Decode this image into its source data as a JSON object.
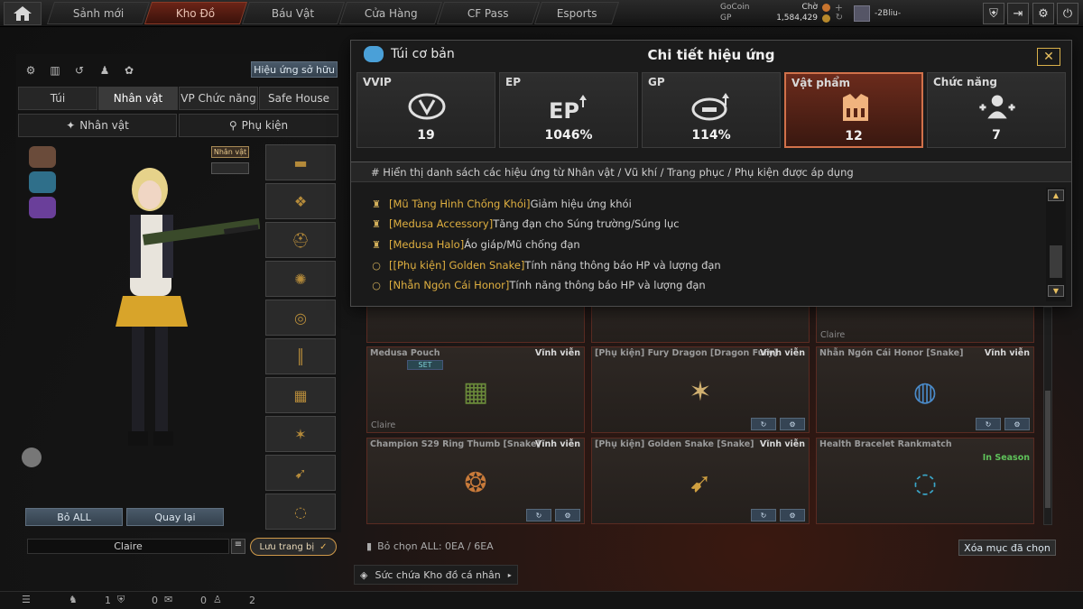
{
  "nav": {
    "tabs": [
      "Sảnh mới",
      "Kho Đồ",
      "Báu Vật",
      "Cửa Hàng",
      "CF Pass",
      "Esports"
    ],
    "active_tab": "Kho Đồ"
  },
  "currency": {
    "gocoin_label": "GoCoin",
    "gp_label": "GP",
    "gocoin_value": "Chờ",
    "gp_value": "1,584,429"
  },
  "user": {
    "name": "-2Bliu-"
  },
  "left": {
    "owned_effects_button": "Hiệu ứng sở hữu",
    "tabs": [
      "Túi",
      "Nhân vật",
      "VP Chức năng",
      "Safe House"
    ],
    "subtabs": [
      "Nhân vật",
      "Phụ kiện"
    ],
    "character_badge": "Nhân vật",
    "clear_all_button": "Bỏ ALL",
    "back_button": "Quay lại",
    "character_name": "Claire",
    "save_button": "Lưu trang bị"
  },
  "dialog": {
    "bag_title": "Túi cơ bản",
    "title": "Chi tiết hiệu ứng",
    "stats": [
      {
        "label": "VVIP",
        "value": "19",
        "icon": "vvip-icon"
      },
      {
        "label": "EP",
        "value": "1046%",
        "icon": "ep-up-icon"
      },
      {
        "label": "GP",
        "value": "114%",
        "icon": "gp-up-icon"
      },
      {
        "label": "Vật phẩm",
        "value": "12",
        "icon": "vest-icon"
      },
      {
        "label": "Chức năng",
        "value": "7",
        "icon": "function-users-icon"
      }
    ],
    "active_stat": "Vật phẩm",
    "list_header": "# Hiển thị danh sách các hiệu ứng từ Nhân vật / Vũ khí / Trang phục / Phụ kiện được áp dụng",
    "effects": [
      {
        "name": "[Mũ Tàng Hình Chống Khói]",
        "desc": "Giảm hiệu ứng khói",
        "icon": "vest-icon"
      },
      {
        "name": "[Medusa Accessory]",
        "desc": "Tăng đạn cho Súng trường/Súng lục",
        "icon": "vest-icon"
      },
      {
        "name": "[Medusa Halo]",
        "desc": "Áo giáp/Mũ chống đạn",
        "icon": "vest-icon"
      },
      {
        "name": "[[Phụ kiện] Golden Snake]",
        "desc": "Tính năng thông báo HP và lượng đạn",
        "icon": "ring-icon"
      },
      {
        "name": "[Nhẫn Ngón Cái Honor]",
        "desc": "Tính năng thông báo HP và lượng đạn",
        "icon": "ring-icon"
      }
    ]
  },
  "inventory": {
    "row0_owner": "Claire",
    "cards": [
      {
        "title": "Medusa Pouch",
        "duration": "Vĩnh viễn",
        "owner": "Claire",
        "badge": "SET"
      },
      {
        "title": "[Phụ kiện] Fury Dragon [Dragon Fury]",
        "duration": "Vĩnh viễn",
        "owner": "",
        "badge": ""
      },
      {
        "title": "Nhẫn Ngón Cái Honor [Snake]",
        "duration": "Vĩnh viễn",
        "owner": "",
        "badge": ""
      },
      {
        "title": "Champion S29 Ring Thumb [Snake]",
        "duration": "Vĩnh viễn",
        "owner": "",
        "badge": ""
      },
      {
        "title": "[Phụ kiện] Golden Snake [Snake]",
        "duration": "Vĩnh viễn",
        "owner": "",
        "badge": ""
      },
      {
        "title": "Health Bracelet Rankmatch",
        "duration": "In Season",
        "owner": "",
        "badge": ""
      }
    ],
    "selection_text": "Bỏ chọn ALL: 0EA / 6EA",
    "clear_selected_button": "Xóa mục đã chọn",
    "capacity_label": "Sức chứa Kho đồ cá nhân"
  },
  "status_bar": {
    "count1": "1",
    "count2": "0",
    "count3": "0",
    "count4": "2"
  },
  "colors": {
    "accent": "#d1714a",
    "effect_name": "#e0b040",
    "in_season": "#5ec15a"
  }
}
